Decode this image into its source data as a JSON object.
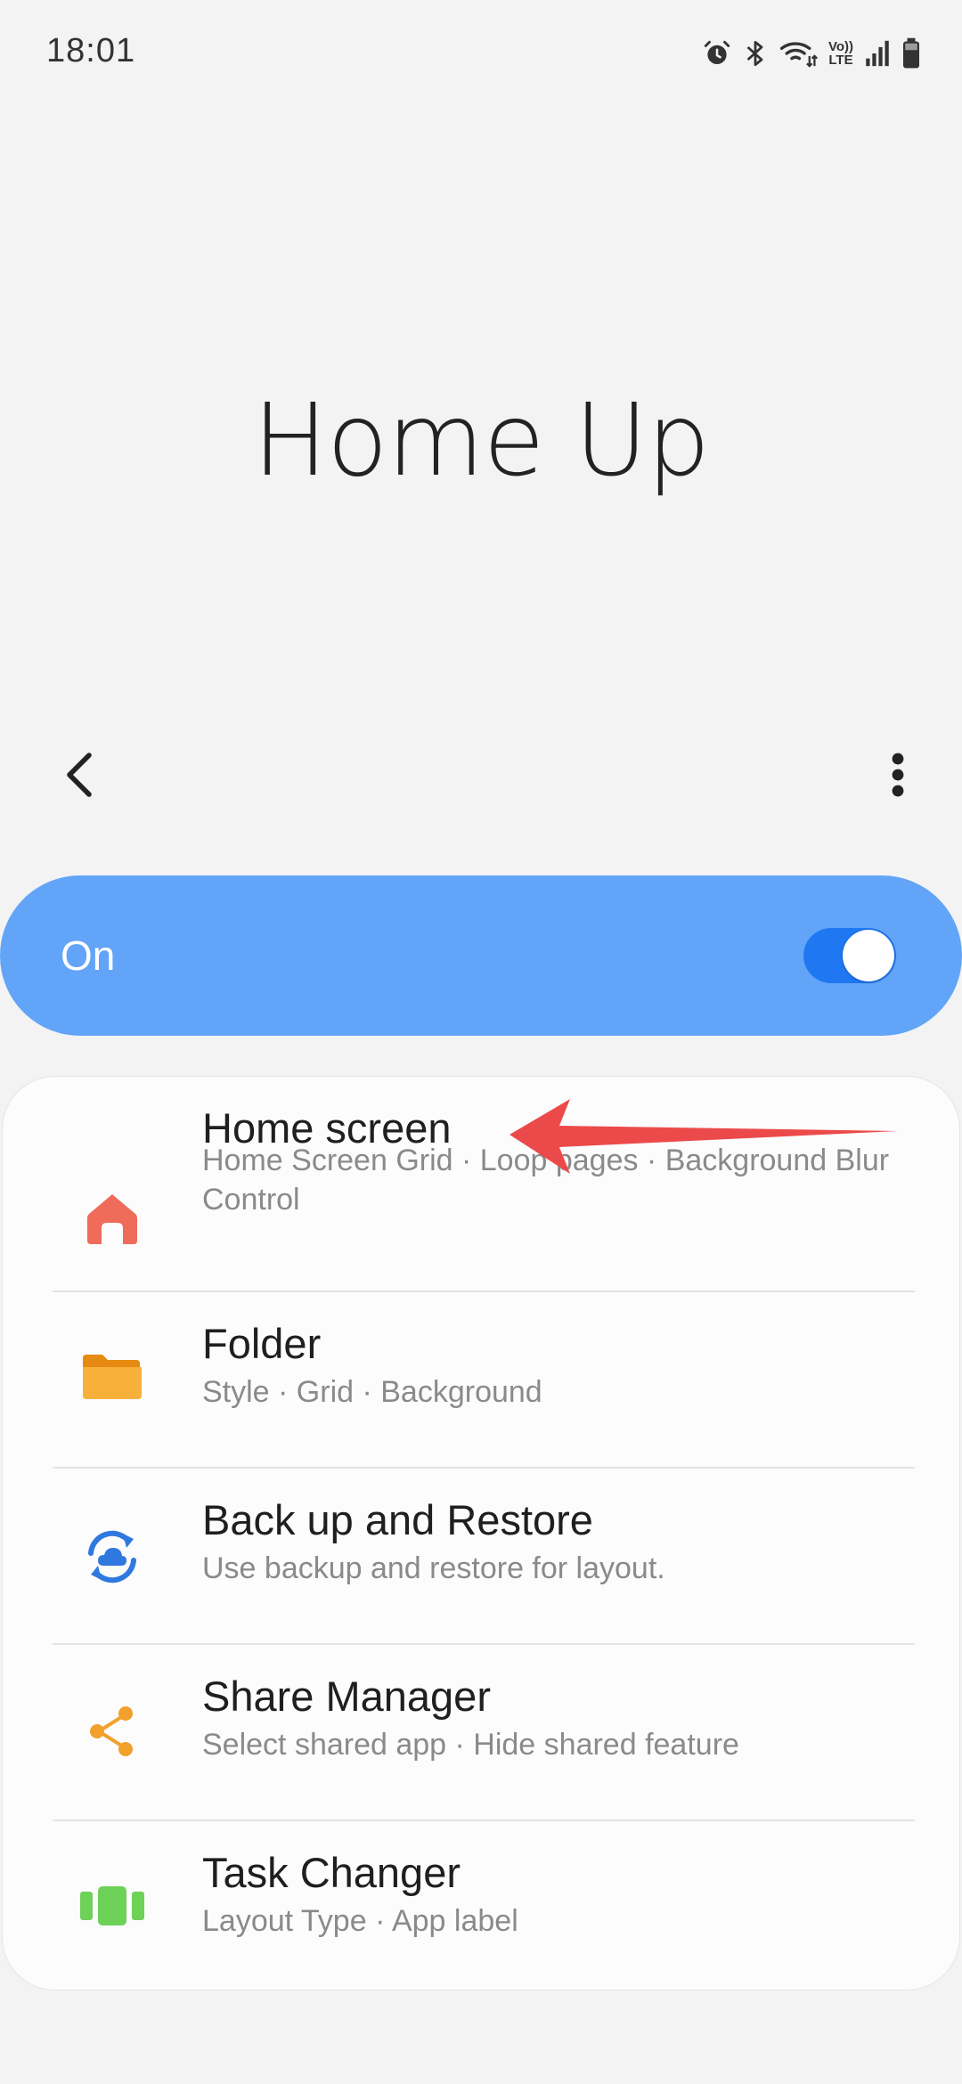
{
  "status_bar": {
    "time": "18:01",
    "icons": [
      "alarm-icon",
      "bluetooth-icon",
      "wifi-icon",
      "volte-icon",
      "signal-icon",
      "battery-icon"
    ],
    "volte_text_top": "Vo))",
    "volte_text_bottom": "LTE"
  },
  "header": {
    "title": "Home Up"
  },
  "master_switch": {
    "label": "On",
    "state": "on",
    "bar_color": "#62a4f8",
    "toggle_color": "#1f78f2"
  },
  "menu": {
    "items": [
      {
        "icon": "home-icon",
        "title": "Home screen",
        "subtitle": "Home Screen Grid · Loop pages · Background Blur Control",
        "icon_color": "#ef6b5a"
      },
      {
        "icon": "folder-icon",
        "title": "Folder",
        "subtitle": "Style · Grid · Background",
        "icon_color": "#f5a623"
      },
      {
        "icon": "backup-restore-icon",
        "title": "Back up and Restore",
        "subtitle": "Use backup and restore for layout.",
        "icon_color": "#2f78e0"
      },
      {
        "icon": "share-icon",
        "title": "Share Manager",
        "subtitle": "Select shared app · Hide shared feature",
        "icon_color": "#f1a02b"
      },
      {
        "icon": "task-changer-icon",
        "title": "Task Changer",
        "subtitle": "Layout Type · App label",
        "icon_color": "#6ed158"
      }
    ]
  },
  "annotation": {
    "icon": "red-arrow-icon",
    "color": "#ec4a4a"
  }
}
